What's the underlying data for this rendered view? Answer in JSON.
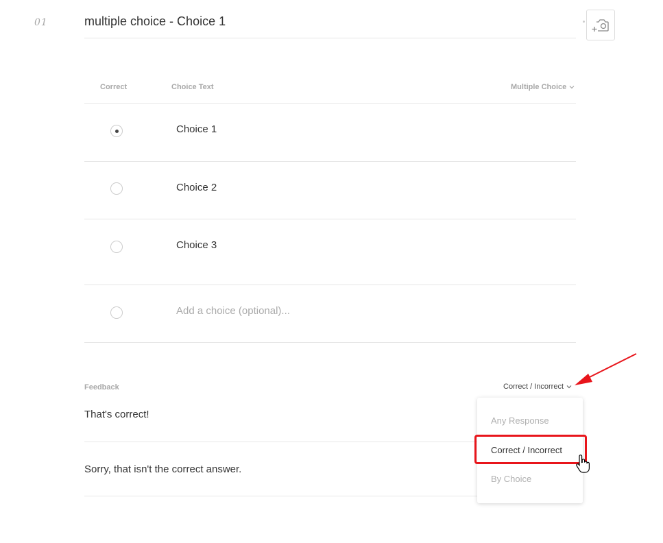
{
  "question": {
    "number": "01",
    "title": "multiple choice - Choice 1"
  },
  "choices_header": {
    "correct": "Correct",
    "choice_text": "Choice Text",
    "type": "Multiple Choice"
  },
  "choices": [
    {
      "label": "Choice 1",
      "checked": true
    },
    {
      "label": "Choice 2",
      "checked": false
    },
    {
      "label": "Choice 3",
      "checked": false
    }
  ],
  "add_choice_placeholder": "Add a choice (optional)...",
  "feedback": {
    "label": "Feedback",
    "mode": "Correct / Incorrect",
    "correct_text": "That's correct!",
    "incorrect_text": "Sorry, that isn't the correct answer."
  },
  "feedback_menu": {
    "options": [
      "Any Response",
      "Correct / Incorrect",
      "By Choice"
    ],
    "selected": "Correct / Incorrect"
  },
  "icons": {
    "camera": "add-image-camera-icon",
    "chevron": "chevron-down-icon",
    "arrow": "red-annotation-arrow",
    "cursor": "hand-pointer-cursor"
  },
  "colors": {
    "highlight": "#e8151b",
    "muted": "#a8a8a8",
    "text": "#333333"
  }
}
